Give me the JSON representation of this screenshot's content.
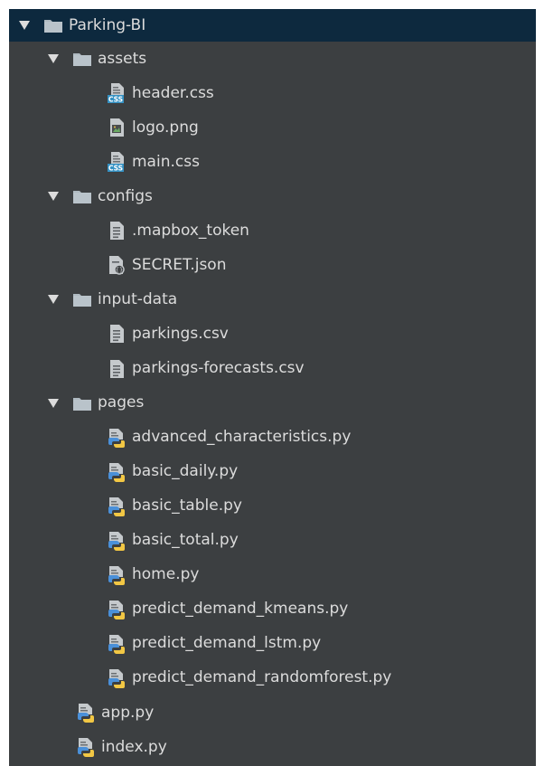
{
  "project_tree": {
    "root": {
      "label": "Parking-BI",
      "expanded": true,
      "selected": true
    },
    "folders": [
      {
        "label": "assets",
        "expanded": true,
        "files": [
          {
            "label": "header.css",
            "icon": "css-file-icon"
          },
          {
            "label": "logo.png",
            "icon": "image-file-icon"
          },
          {
            "label": "main.css",
            "icon": "css-file-icon"
          }
        ]
      },
      {
        "label": "configs",
        "expanded": true,
        "files": [
          {
            "label": ".mapbox_token",
            "icon": "text-file-icon"
          },
          {
            "label": "SECRET.json",
            "icon": "json-file-icon"
          }
        ]
      },
      {
        "label": "input-data",
        "expanded": true,
        "files": [
          {
            "label": "parkings.csv",
            "icon": "text-file-icon"
          },
          {
            "label": "parkings-forecasts.csv",
            "icon": "text-file-icon"
          }
        ]
      },
      {
        "label": "pages",
        "expanded": true,
        "files": [
          {
            "label": "advanced_characteristics.py",
            "icon": "python-file-icon"
          },
          {
            "label": "basic_daily.py",
            "icon": "python-file-icon"
          },
          {
            "label": "basic_table.py",
            "icon": "python-file-icon"
          },
          {
            "label": "basic_total.py",
            "icon": "python-file-icon"
          },
          {
            "label": "home.py",
            "icon": "python-file-icon"
          },
          {
            "label": "predict_demand_kmeans.py",
            "icon": "python-file-icon"
          },
          {
            "label": "predict_demand_lstm.py",
            "icon": "python-file-icon"
          },
          {
            "label": "predict_demand_randomforest.py",
            "icon": "python-file-icon"
          }
        ]
      }
    ],
    "root_files": [
      {
        "label": "app.py",
        "icon": "python-file-icon"
      },
      {
        "label": "index.py",
        "icon": "python-file-icon"
      }
    ]
  },
  "colors": {
    "background": "#3c3f41",
    "selected_row": "#0d293e",
    "text": "#dcdcdc",
    "folder": "#aeb9c0",
    "css_badge": "#3592c4",
    "python_blue": "#4a90d9",
    "python_yellow": "#f2c744"
  }
}
